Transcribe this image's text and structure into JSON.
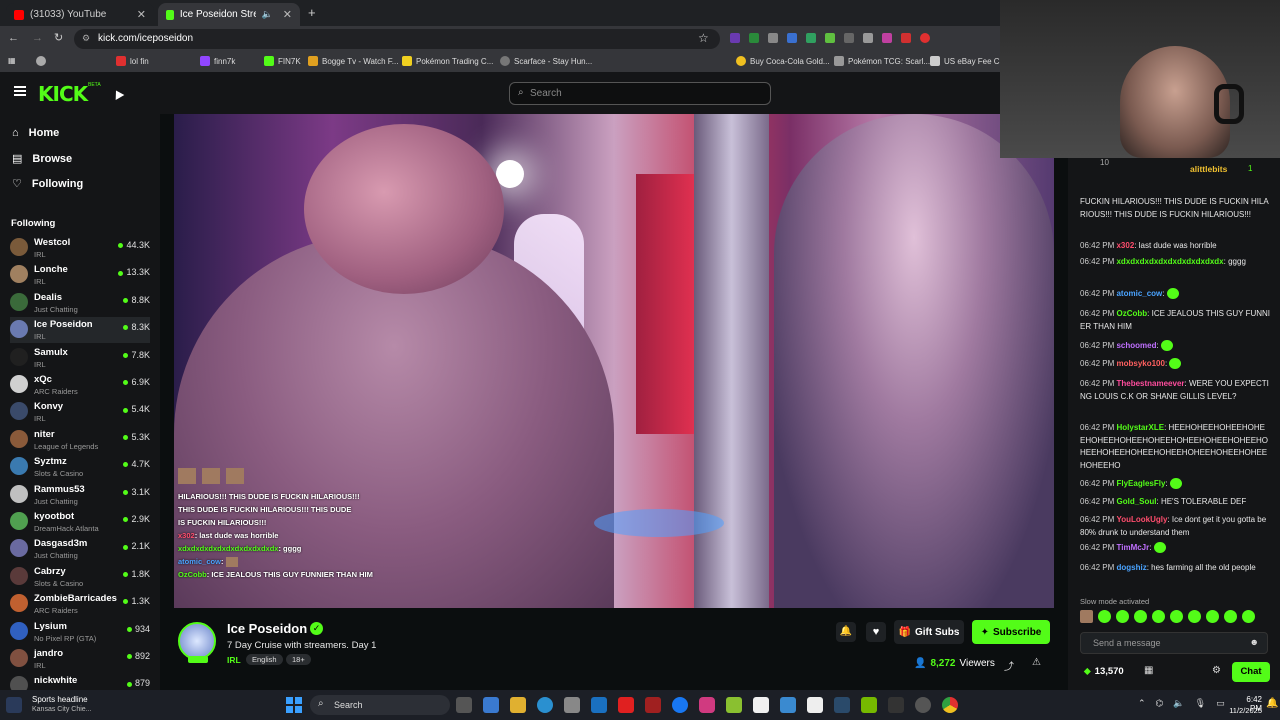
{
  "browser": {
    "tabs": [
      {
        "label": "(31033) YouTube",
        "active": false
      },
      {
        "label": "Ice Poseidon Stream - Watc",
        "active": true
      }
    ],
    "url": "kick.com/iceposeidon",
    "bookmarks": [
      "lol fin",
      "finn7k",
      "FIN7K",
      "Bogge Tv - Watch F...",
      "Scarface - Stay Hun...",
      "Pokémon Trading C...",
      "Buy Coca-Cola Gold...",
      "Pokémon TCG: Scarl...",
      "US eBay Fee Calc"
    ]
  },
  "kick": {
    "logo": "KICK",
    "logo_badge": "BETA",
    "search_placeholder": "Search"
  },
  "sidebar": {
    "nav": [
      {
        "label": "Home",
        "icon": "home-icon"
      },
      {
        "label": "Browse",
        "icon": "browse-icon"
      },
      {
        "label": "Following",
        "icon": "heart-icon"
      }
    ],
    "following_heading": "Following",
    "following": [
      {
        "name": "Westcol",
        "category": "IRL",
        "viewers": "44.3K",
        "color": "#7a5a3a"
      },
      {
        "name": "Lonche",
        "category": "IRL",
        "viewers": "13.3K",
        "color": "#a08060"
      },
      {
        "name": "Dealis",
        "category": "Just Chatting",
        "viewers": "8.8K",
        "color": "#3a6a3a"
      },
      {
        "name": "Ice Poseidon",
        "category": "IRL",
        "viewers": "8.3K",
        "color": "#6a7ab0"
      },
      {
        "name": "Samulx",
        "category": "IRL",
        "viewers": "7.8K",
        "color": "#202020"
      },
      {
        "name": "xQc",
        "category": "ARC Raiders",
        "viewers": "6.9K",
        "color": "#d0d0d0"
      },
      {
        "name": "Konvy",
        "category": "IRL",
        "viewers": "5.4K",
        "color": "#3a4a6a"
      },
      {
        "name": "niter",
        "category": "League of Legends",
        "viewers": "5.3K",
        "color": "#8a5a3a"
      },
      {
        "name": "Syztmz",
        "category": "Slots & Casino",
        "viewers": "4.7K",
        "color": "#3a7ab0"
      },
      {
        "name": "Rammus53",
        "category": "Just Chatting",
        "viewers": "3.1K",
        "color": "#c0c0c0"
      },
      {
        "name": "kyootbot",
        "category": "DreamHack Atlanta",
        "viewers": "2.9K",
        "color": "#50a050"
      },
      {
        "name": "Dasgasd3m",
        "category": "Just Chatting",
        "viewers": "2.1K",
        "color": "#6a6aa0"
      },
      {
        "name": "Cabrzy",
        "category": "Slots & Casino",
        "viewers": "1.8K",
        "color": "#5a3a3a"
      },
      {
        "name": "ZombieBarricades",
        "category": "ARC Raiders",
        "viewers": "1.3K",
        "color": "#c06030"
      },
      {
        "name": "Lysium",
        "category": "No Pixel RP (GTA)",
        "viewers": "934",
        "color": "#3060c0"
      },
      {
        "name": "jandro",
        "category": "IRL",
        "viewers": "892",
        "color": "#805040"
      },
      {
        "name": "nickwhite",
        "category": "",
        "viewers": "879",
        "color": "#505050"
      }
    ]
  },
  "video_overlay_chat": [
    {
      "user": "",
      "text": "HILARIOUS!!! THIS DUDE IS FUCKIN HILARIOUS!!!"
    },
    {
      "user": "",
      "text": "THIS DUDE IS FUCKIN HILARIOUS!!! THIS DUDE"
    },
    {
      "user": "",
      "text": "IS FUCKIN HILARIOUS!!!"
    },
    {
      "user": "x302",
      "text": "last dude was horrible"
    },
    {
      "user": "xdxdxdxdxdxdxdxdxdxdxdx",
      "text": "gggg"
    },
    {
      "user": "atomic_cow",
      "text": ""
    },
    {
      "user": "OzCobb",
      "text": "ICE JEALOUS THIS GUY FUNNIER THAN HIM"
    }
  ],
  "streamer": {
    "name": "Ice Poseidon",
    "title": "7 Day Cruise with streamers. Day 1",
    "category": "IRL",
    "tags": [
      "English",
      "18+"
    ],
    "viewers": "8,272",
    "viewers_label": "Viewers",
    "gift_label": "Gift Subs",
    "subscribe_label": "Subscribe"
  },
  "chat": {
    "top_user": "alittlebits",
    "top_count": "10",
    "top_right_count": "1",
    "messages": [
      {
        "time": "",
        "user": "",
        "userColor": "#ffffff",
        "text": "FUCKIN HILARIOUS!!! THIS DUDE IS FUCKIN HILARIOUS!!! THIS DUDE IS FUCKIN HILARIOUS!!!"
      },
      {
        "time": "06:42 PM",
        "user": "x302",
        "userColor": "#ff4d6d",
        "text": "last dude was horrible"
      },
      {
        "time": "06:42 PM",
        "user": "xdxdxdxdxdxdxdxdxdxdxdx",
        "userColor": "#53fc18",
        "text": "gggg"
      },
      {
        "time": "06:42 PM",
        "user": "atomic_cow",
        "userColor": "#4aa3ff",
        "text": ""
      },
      {
        "time": "06:42 PM",
        "user": "OzCobb",
        "userColor": "#53fc18",
        "text": "ICE JEALOUS THIS GUY FUNNIER THAN HIM"
      },
      {
        "time": "06:42 PM",
        "user": "schoomed",
        "userColor": "#c070ff",
        "text": ""
      },
      {
        "time": "06:42 PM",
        "user": "mobsyko100",
        "userColor": "#ff6060",
        "text": ""
      },
      {
        "time": "06:42 PM",
        "user": "Thebestnameever",
        "userColor": "#ff4d9d",
        "text": "WERE YOU EXPECTING LOUIS C.K OR SHANE GILLIS LEVEL?"
      },
      {
        "time": "06:42 PM",
        "user": "HolystarXLE",
        "userColor": "#53fc18",
        "text": "HEEHOHEEHOHEEHOHEEHOHEEHOHEEHOHEEHOHEEHOHEEHOHEEHOHEEHOHEEHOHEEHOHEEHOHEEHOHEEHOHEEHOHEEHO"
      },
      {
        "time": "06:42 PM",
        "user": "FlyEaglesFly",
        "userColor": "#53fc18",
        "text": ""
      },
      {
        "time": "06:42 PM",
        "user": "Gold_Soul",
        "userColor": "#53fc18",
        "text": "HE'S TOLERABLE DEF"
      },
      {
        "time": "06:42 PM",
        "user": "YouLookUgly",
        "userColor": "#ff4d6d",
        "text": "Ice dont get it you gotta be 80% drunk to understand them"
      },
      {
        "time": "06:42 PM",
        "user": "TimMcJr",
        "userColor": "#c070ff",
        "text": ""
      },
      {
        "time": "06:42 PM",
        "user": "dogshiz",
        "userColor": "#4aa3ff",
        "text": "hes farming all the old people"
      }
    ],
    "slow_mode": "Slow mode activated",
    "input_placeholder": "Send a message",
    "points": "13,570",
    "chat_button": "Chat"
  },
  "taskbar": {
    "search_label": "Search",
    "news_title": "Sports headline",
    "news_sub": "Kansas City Chie...",
    "time": "6:42 PM",
    "date": "11/2/2025"
  }
}
